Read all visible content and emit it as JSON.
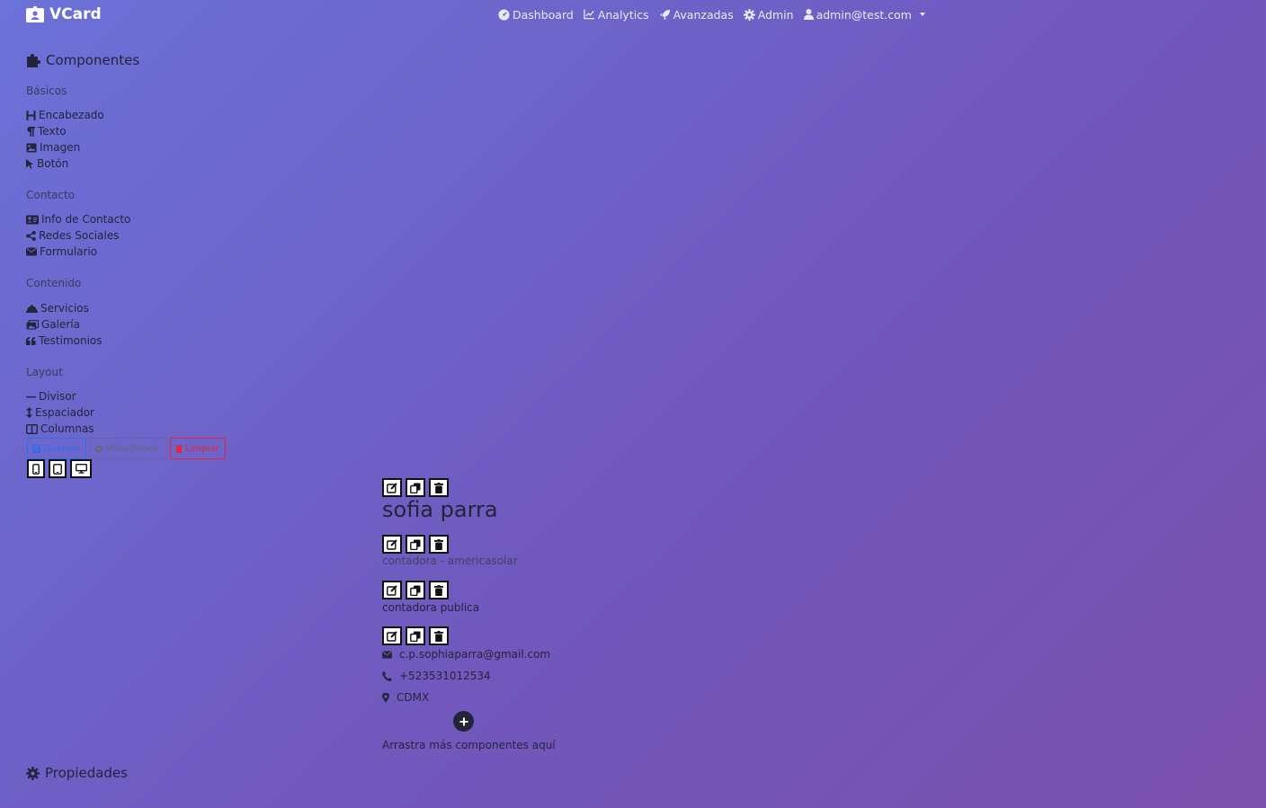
{
  "header": {
    "brand": "VCard",
    "nav": [
      {
        "label": "Dashboard",
        "icon": "dashboard-icon"
      },
      {
        "label": "Analytics",
        "icon": "chart-line-icon"
      },
      {
        "label": "Avanzadas",
        "icon": "rocket-icon"
      },
      {
        "label": "Admin",
        "icon": "gear-icon"
      }
    ],
    "user": "admin@test.com"
  },
  "sidebar": {
    "components_title": "Componentes",
    "groups": [
      {
        "title": "Básicos",
        "items": [
          {
            "label": "Encabezado",
            "icon": "heading-icon"
          },
          {
            "label": "Texto",
            "icon": "paragraph-icon"
          },
          {
            "label": "Imagen",
            "icon": "image-icon"
          },
          {
            "label": "Botón",
            "icon": "pointer-icon"
          }
        ]
      },
      {
        "title": "Contacto",
        "items": [
          {
            "label": "Info de Contacto",
            "icon": "address-card-icon"
          },
          {
            "label": "Redes Sociales",
            "icon": "share-icon"
          },
          {
            "label": "Formulario",
            "icon": "envelope-icon"
          }
        ]
      },
      {
        "title": "Contenido",
        "items": [
          {
            "label": "Servicios",
            "icon": "concierge-bell-icon"
          },
          {
            "label": "Galería",
            "icon": "images-icon"
          },
          {
            "label": "Testimonios",
            "icon": "quote-icon"
          }
        ]
      },
      {
        "title": "Layout",
        "items": [
          {
            "label": "Divisor",
            "icon": "minus-icon"
          },
          {
            "label": "Espaciador",
            "icon": "arrows-vertical-icon"
          },
          {
            "label": "Columnas",
            "icon": "columns-icon"
          }
        ]
      }
    ],
    "actions": {
      "save": "Guardar",
      "preview": "Vista Previa",
      "clear": "Limpiar"
    },
    "properties_title": "Propiedades"
  },
  "canvas": {
    "heading": "sofia parra",
    "subtitle": "contadora - americasolar",
    "text": "contadora publica",
    "contact": {
      "email": "c.p.sophiaparra@gmail.com",
      "phone": "+523531012534",
      "location": "CDMX"
    },
    "drop_hint": "Arrastra más componentes aquí"
  },
  "colors": {
    "save": "#2b6ef0",
    "clear": "#e0273d",
    "text_dark": "#23233a"
  }
}
